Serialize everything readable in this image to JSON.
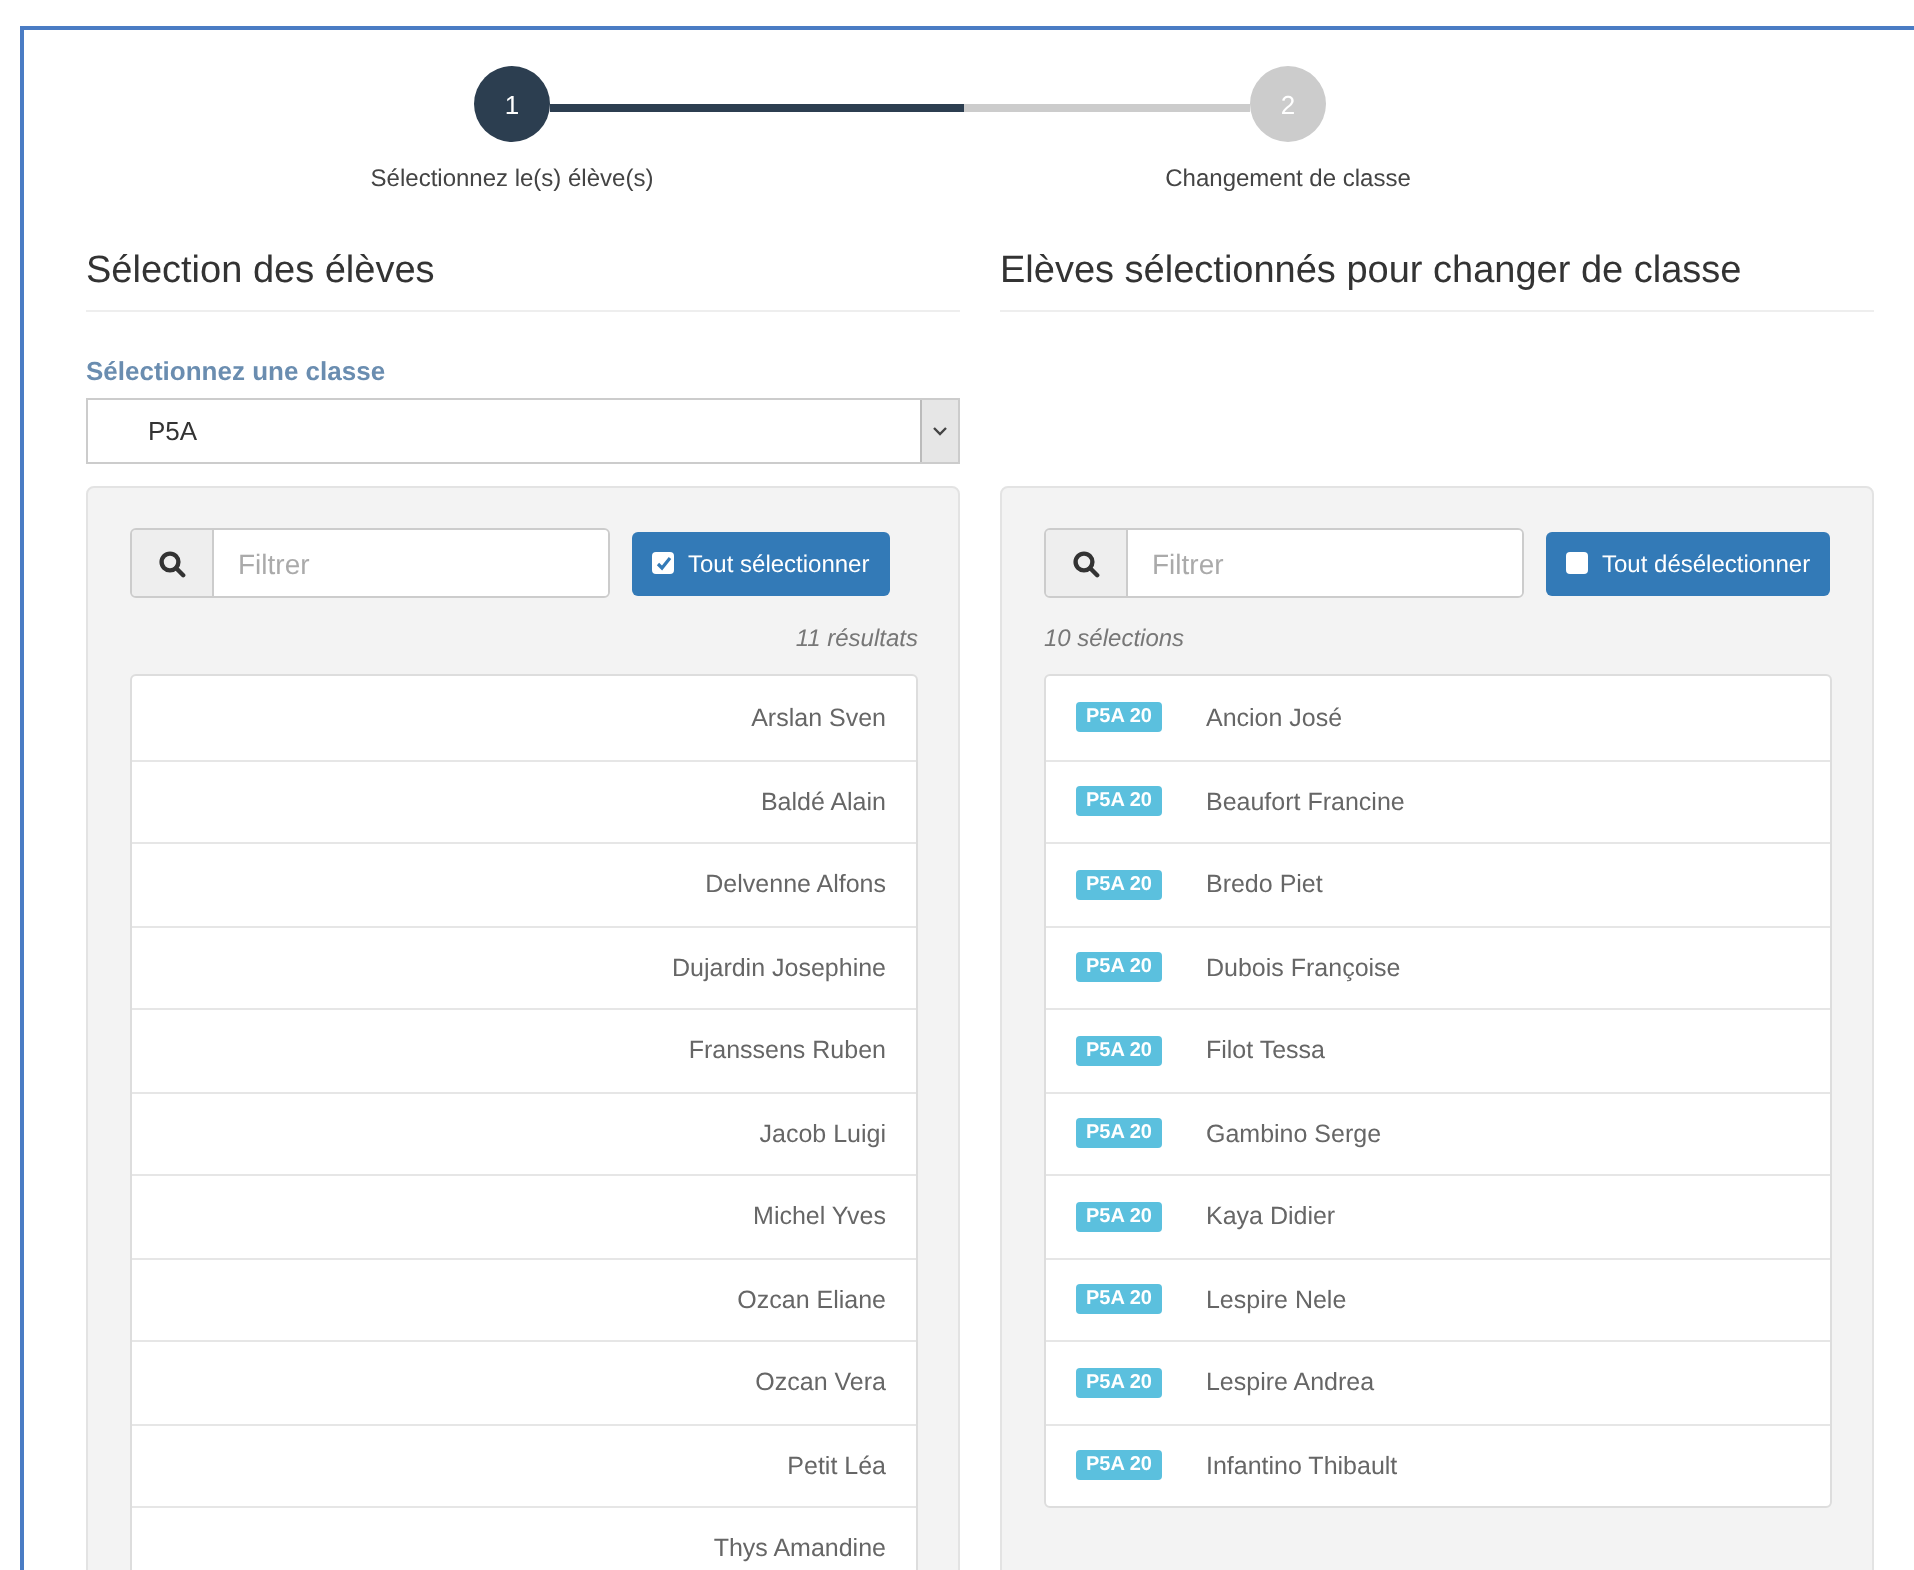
{
  "stepper": {
    "level": 0.59,
    "steps": [
      {
        "number": "1",
        "label": "Sélectionnez le(s) élève(s)",
        "selected": true
      },
      {
        "number": "2",
        "label": "Changement de classe",
        "selected": false
      }
    ]
  },
  "left": {
    "title": "Sélection des élèves",
    "class_label": "Sélectionnez une classe",
    "class_value": "P5A",
    "filter": {
      "placeholder": "Filtrer"
    },
    "button": {
      "label": "Tout sélectionner",
      "checked": true
    },
    "count": "11 résultats",
    "students": [
      "Arslan Sven",
      "Baldé Alain",
      "Delvenne Alfons",
      "Dujardin Josephine",
      "Franssens Ruben",
      "Jacob Luigi",
      "Michel Yves",
      "Ozcan Eliane",
      "Ozcan Vera",
      "Petit Léa",
      "Thys Amandine"
    ]
  },
  "right": {
    "title": "Elèves sélectionnés pour changer de classe",
    "filter": {
      "placeholder": "Filtrer"
    },
    "button": {
      "label": "Tout désélectionner",
      "checked": false
    },
    "count": "10 sélections",
    "students": [
      {
        "badge": "P5A 20",
        "name": "Ancion José"
      },
      {
        "badge": "P5A 20",
        "name": "Beaufort Francine"
      },
      {
        "badge": "P5A 20",
        "name": "Bredo Piet"
      },
      {
        "badge": "P5A 20",
        "name": "Dubois Françoise"
      },
      {
        "badge": "P5A 20",
        "name": "Filot Tessa"
      },
      {
        "badge": "P5A 20",
        "name": "Gambino Serge"
      },
      {
        "badge": "P5A 20",
        "name": "Kaya Didier"
      },
      {
        "badge": "P5A 20",
        "name": "Lespire Nele"
      },
      {
        "badge": "P5A 20",
        "name": "Lespire Andrea"
      },
      {
        "badge": "P5A 20",
        "name": "Infantino Thibault"
      }
    ]
  }
}
